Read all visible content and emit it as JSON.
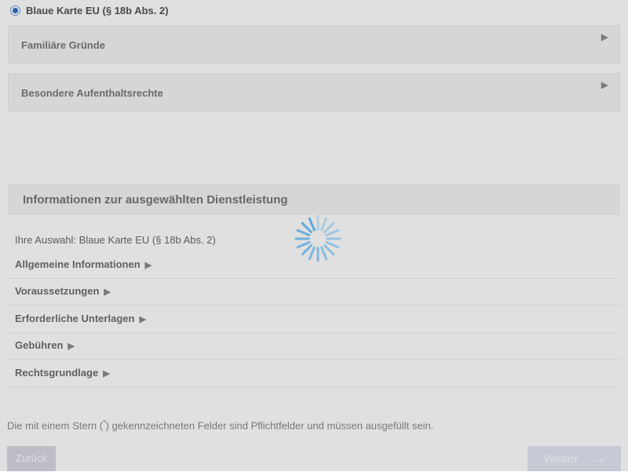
{
  "radio": {
    "label": "Blaue Karte EU (§ 18b Abs. 2)",
    "checked": true
  },
  "accordions": [
    {
      "label": "Familiäre Gründe",
      "icon": "triangle-right-icon"
    },
    {
      "label": "Besondere Aufenthaltsrechte",
      "icon": "triangle-right-icon"
    }
  ],
  "info": {
    "title": "Informationen zur ausgewählten Dienstleistung",
    "selection": "Ihre Auswahl: Blaue Karte EU (§ 18b Abs. 2)",
    "sections": [
      {
        "label": "Allgemeine Informationen",
        "arrow": "▶"
      },
      {
        "label": "Voraussetzungen",
        "arrow": "▶"
      },
      {
        "label": "Erforderliche Unterlagen",
        "arrow": "▶"
      },
      {
        "label": "Gebühren",
        "arrow": "▶"
      },
      {
        "label": "Rechtsgrundlage",
        "arrow": "▶"
      }
    ]
  },
  "note": {
    "before": "Die mit einem Stern (",
    "star": "*",
    "after": ") gekennzeichneten Felder sind Pflichtfelder und müssen ausgefüllt sein."
  },
  "buttons": {
    "back": "Zurück",
    "next": "Weiter",
    "next_icon": "→"
  },
  "colors": {
    "accent": "#2a6fc0",
    "spinner": "#5aa6dc"
  }
}
